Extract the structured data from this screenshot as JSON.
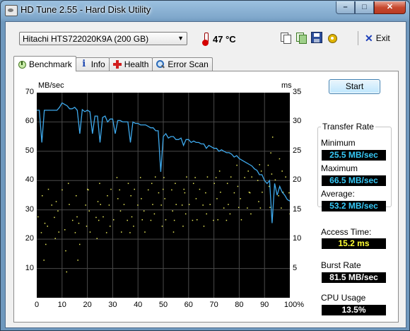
{
  "window": {
    "title": "HD Tune 2.55 - Hard Disk Utility",
    "min": "–",
    "max": "□",
    "close": "✕"
  },
  "toolbar": {
    "drive": "Hitachi HTS722020K9A (200 GB)",
    "temperature": "47 °C",
    "exit_label": "Exit",
    "icons": [
      "copy-text-icon",
      "copy-screenshot-icon",
      "save-icon",
      "options-icon",
      "exit-icon",
      "thermometer-icon"
    ]
  },
  "tabs": [
    {
      "label": "Benchmark",
      "active": true
    },
    {
      "label": "Info",
      "active": false
    },
    {
      "label": "Health",
      "active": false
    },
    {
      "label": "Error Scan",
      "active": false
    }
  ],
  "controls": {
    "start_label": "Start"
  },
  "stats": {
    "transfer_rate_title": "Transfer Rate",
    "minimum_label": "Minimum",
    "minimum_value": "25.5 MB/sec",
    "maximum_label": "Maximum",
    "maximum_value": "66.5 MB/sec",
    "average_label": "Average:",
    "average_value": "53.2 MB/sec",
    "access_time_label": "Access Time:",
    "access_time_value": "15.2 ms",
    "burst_rate_label": "Burst Rate",
    "burst_rate_value": "81.5 MB/sec",
    "cpu_usage_label": "CPU Usage",
    "cpu_usage_value": "13.5%"
  },
  "colors": {
    "transfer_line": "#3ea9ec",
    "access_points": "#e8e85a",
    "plot_bg": "#000000",
    "grid": "#4a4a4a"
  },
  "chart_data": {
    "type": "line",
    "left_axis_label": "MB/sec",
    "right_axis_label": "ms",
    "left_ticks": [
      "70",
      "60",
      "50",
      "40",
      "30",
      "20",
      "10"
    ],
    "right_ticks": [
      "35",
      "30",
      "25",
      "20",
      "15",
      "10",
      "5"
    ],
    "x_ticks": [
      "0",
      "10",
      "20",
      "30",
      "40",
      "50",
      "60",
      "70",
      "80",
      "90",
      "100%"
    ],
    "xlim": [
      0,
      100
    ],
    "ylim_left": [
      0,
      70
    ],
    "ylim_right": [
      0,
      35
    ],
    "grid": true,
    "series": [
      {
        "kind": "transfer",
        "axis": "left",
        "x": [
          0,
          1,
          2,
          3,
          4,
          5,
          6,
          7,
          8,
          9,
          10,
          11,
          12,
          13,
          14,
          15,
          16,
          17,
          18,
          19,
          20,
          21,
          22,
          23,
          24,
          25,
          26,
          27,
          28,
          29,
          30,
          31,
          32,
          33,
          34,
          35,
          36,
          37,
          38,
          39,
          40,
          41,
          42,
          43,
          44,
          45,
          46,
          47,
          48,
          49,
          50,
          51,
          52,
          53,
          54,
          55,
          56,
          57,
          58,
          59,
          60,
          61,
          62,
          63,
          64,
          65,
          66,
          67,
          68,
          69,
          70,
          71,
          72,
          73,
          74,
          75,
          76,
          77,
          78,
          79,
          80,
          81,
          82,
          83,
          84,
          85,
          86,
          87,
          88,
          89,
          90,
          91,
          92,
          93,
          94,
          95,
          96,
          97,
          98,
          99,
          100
        ],
        "y": [
          64,
          64,
          53,
          64,
          64,
          64,
          64,
          64,
          64,
          65,
          66.5,
          66,
          65.5,
          64.5,
          64.5,
          65,
          64,
          56,
          64.2,
          63.5,
          64,
          63.5,
          56,
          62,
          62,
          53,
          61.5,
          62,
          60,
          61,
          61,
          56,
          60.5,
          60.5,
          60,
          60,
          60,
          53,
          60,
          59.5,
          59.5,
          59,
          59,
          59,
          58.5,
          58,
          58,
          57,
          57,
          43,
          55,
          56,
          54.5,
          55,
          55,
          54,
          54,
          54.5,
          52,
          54,
          54,
          53,
          53.5,
          53,
          53,
          52.5,
          52.5,
          51,
          52,
          51.5,
          51,
          51,
          50,
          50.5,
          50,
          49.5,
          49.5,
          49,
          48,
          48.5,
          47.5,
          47,
          46.5,
          46,
          45.5,
          45,
          44,
          43.5,
          42,
          42,
          40,
          39,
          40,
          25.5,
          39,
          35,
          38,
          36,
          35,
          33.5,
          33
        ]
      },
      {
        "kind": "access_time",
        "axis": "right",
        "mode": "scatter",
        "note_points": [
          [
            1,
            13
          ],
          [
            3,
            11
          ],
          [
            5,
            15
          ],
          [
            7,
            12
          ],
          [
            9,
            14
          ],
          [
            11,
            9
          ],
          [
            13,
            16
          ],
          [
            15,
            13
          ],
          [
            17,
            11
          ],
          [
            19,
            15
          ],
          [
            21,
            14
          ],
          [
            23,
            12
          ],
          [
            25,
            16
          ],
          [
            27,
            13
          ],
          [
            29,
            15
          ],
          [
            31,
            17
          ],
          [
            33,
            14
          ],
          [
            35,
            16
          ],
          [
            37,
            13
          ],
          [
            39,
            15
          ],
          [
            41,
            17
          ],
          [
            43,
            14
          ],
          [
            45,
            16
          ],
          [
            47,
            18
          ],
          [
            49,
            15
          ],
          [
            51,
            17
          ],
          [
            53,
            14
          ],
          [
            55,
            16
          ],
          [
            57,
            15
          ],
          [
            59,
            18
          ],
          [
            61,
            16
          ],
          [
            63,
            17
          ],
          [
            65,
            15
          ],
          [
            67,
            18
          ],
          [
            69,
            16
          ],
          [
            71,
            17
          ],
          [
            73,
            19
          ],
          [
            75,
            16
          ],
          [
            77,
            18
          ],
          [
            79,
            20
          ],
          [
            81,
            17
          ],
          [
            83,
            19
          ],
          [
            85,
            18
          ],
          [
            87,
            21
          ],
          [
            89,
            19
          ],
          [
            91,
            20
          ],
          [
            93,
            23
          ],
          [
            95,
            22
          ],
          [
            97,
            19
          ],
          [
            99,
            18
          ]
        ]
      }
    ]
  }
}
